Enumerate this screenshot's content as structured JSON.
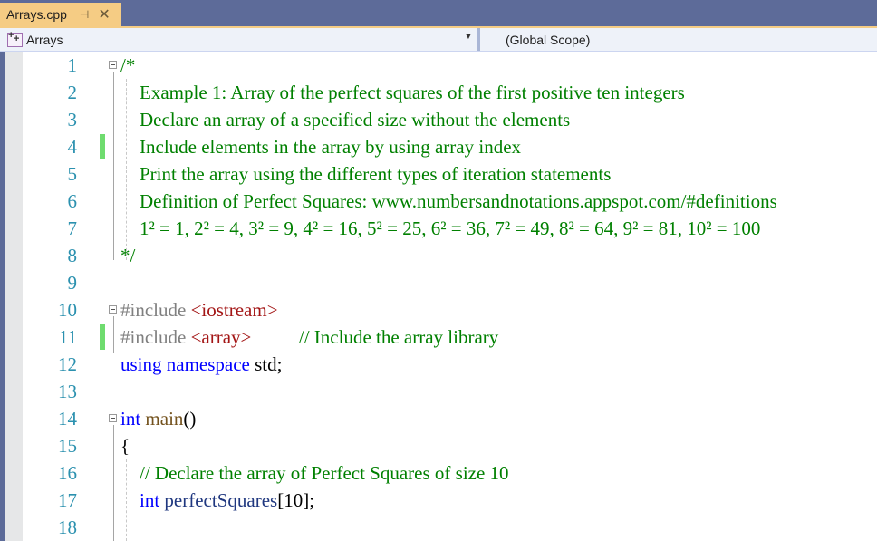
{
  "tab": {
    "title": "Arrays.cpp",
    "pin_icon": "pin-icon",
    "close_icon": "close-icon"
  },
  "navbar": {
    "project": "Arrays",
    "scope": "(Global Scope)"
  },
  "editor": {
    "lines": [
      {
        "n": "1",
        "parts": [
          {
            "t": "/*",
            "c": "com"
          }
        ]
      },
      {
        "n": "2",
        "parts": [
          {
            "t": "    Example 1: Array of the perfect squares of the first positive ten integers",
            "c": "com"
          }
        ]
      },
      {
        "n": "3",
        "parts": [
          {
            "t": "    Declare an array of a specified size without the elements",
            "c": "com"
          }
        ]
      },
      {
        "n": "4",
        "parts": [
          {
            "t": "    Include elements in the array by using array index",
            "c": "com"
          }
        ]
      },
      {
        "n": "5",
        "parts": [
          {
            "t": "    Print the array using the different types of iteration statements",
            "c": "com"
          }
        ]
      },
      {
        "n": "6",
        "parts": [
          {
            "t": "    Definition of Perfect Squares: www.numbersandnotations.appspot.com/#definitions",
            "c": "com"
          }
        ]
      },
      {
        "n": "7",
        "parts": [
          {
            "t": "    1² = 1, 2² = 4, 3² = 9, 4² = 16, 5² = 25, 6² = 36, 7² = 49, 8² = 64, 9² = 81, 10² = 100",
            "c": "com"
          }
        ]
      },
      {
        "n": "8",
        "parts": [
          {
            "t": "*/",
            "c": "com"
          }
        ]
      },
      {
        "n": "9",
        "parts": []
      },
      {
        "n": "10",
        "parts": [
          {
            "t": "#include ",
            "c": "pre"
          },
          {
            "t": "<iostream>",
            "c": "str"
          }
        ]
      },
      {
        "n": "11",
        "parts": [
          {
            "t": "#include ",
            "c": "pre"
          },
          {
            "t": "<array>",
            "c": "str"
          },
          {
            "t": "          // Include the array library",
            "c": "com"
          }
        ]
      },
      {
        "n": "12",
        "parts": [
          {
            "t": "using namespace ",
            "c": "kw"
          },
          {
            "t": "std;",
            "c": "txt"
          }
        ]
      },
      {
        "n": "13",
        "parts": []
      },
      {
        "n": "14",
        "parts": [
          {
            "t": "int ",
            "c": "kw"
          },
          {
            "t": "main",
            "c": "fn"
          },
          {
            "t": "()",
            "c": "txt"
          }
        ]
      },
      {
        "n": "15",
        "parts": [
          {
            "t": "{",
            "c": "txt"
          }
        ]
      },
      {
        "n": "16",
        "parts": [
          {
            "t": "    // Declare the array of Perfect Squares of size 10",
            "c": "com"
          }
        ]
      },
      {
        "n": "17",
        "parts": [
          {
            "t": "    int ",
            "c": "kw"
          },
          {
            "t": "perfectSquares",
            "c": "id"
          },
          {
            "t": "[10];",
            "c": "txt"
          }
        ]
      },
      {
        "n": "18",
        "parts": []
      }
    ],
    "changed_lines": [
      "4",
      "11"
    ],
    "fold_lines": [
      "1",
      "10",
      "14"
    ]
  }
}
